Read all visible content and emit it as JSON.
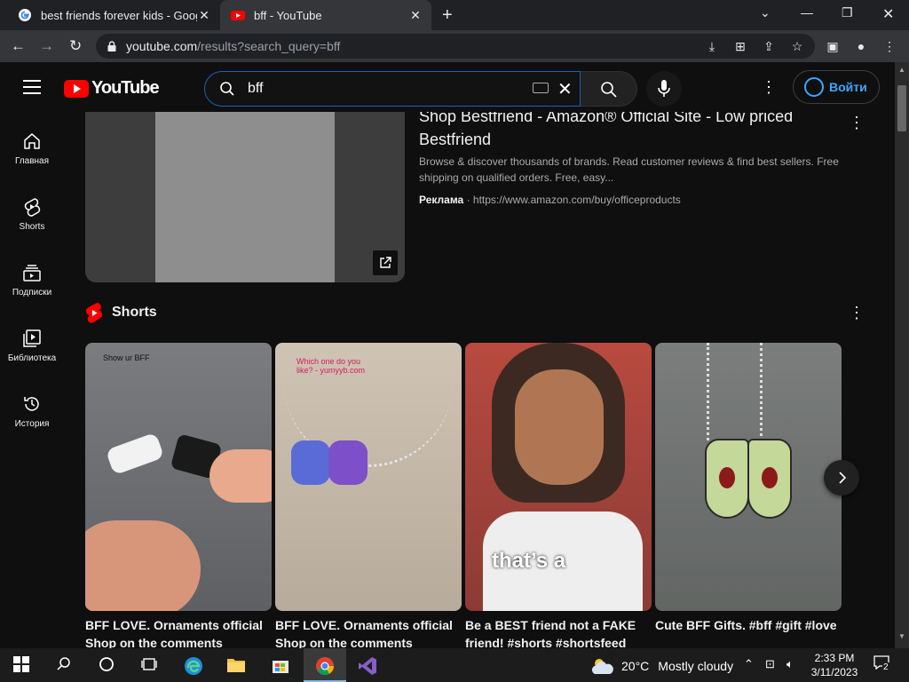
{
  "browser": {
    "tabs": [
      {
        "title": "best friends forever kids - Google",
        "active": false
      },
      {
        "title": "bff - YouTube",
        "active": true
      }
    ],
    "url_domain": "youtube.com",
    "url_path": "/results?search_query=bff"
  },
  "youtube": {
    "logo_text": "YouTube",
    "search_value": "bff",
    "signin_label": "Войти",
    "sidebar": [
      {
        "label": "Главная",
        "icon": "home-icon"
      },
      {
        "label": "Shorts",
        "icon": "shorts-icon"
      },
      {
        "label": "Подписки",
        "icon": "subscriptions-icon"
      },
      {
        "label": "Библиотека",
        "icon": "library-icon"
      },
      {
        "label": "История",
        "icon": "history-icon"
      }
    ],
    "ad": {
      "title": "Shop Bestfriend - Amazon® Official Site - Low priced Bestfriend",
      "description": "Browse & discover thousands of brands. Read customer reviews & find best sellers. Free shipping on qualified orders. Free, easy...",
      "badge": "Реклама",
      "url": "https://www.amazon.com/buy/officeproducts"
    },
    "shorts_heading": "Shorts",
    "shorts": [
      {
        "title": "BFF LOVE. Ornaments official Shop on the comments",
        "overlay": "Show ur BFF"
      },
      {
        "title": "BFF LOVE. Ornaments official Shop on the comments",
        "overlay": "Which one do you like? - yumyyb.com"
      },
      {
        "title": "Be a BEST friend not a FAKE friend! #shorts #shortsfeed",
        "overlay": "that’s a"
      },
      {
        "title": "Cute BFF Gifts. #bff #gift #love",
        "overlay": ""
      }
    ]
  },
  "taskbar": {
    "weather_temp": "20°C",
    "weather_desc": "Mostly cloudy",
    "time": "2:33 PM",
    "date": "3/11/2023",
    "notifications": "2"
  },
  "colors": {
    "youtube_red": "#ff0000",
    "link_blue": "#3ea6ff",
    "focus_blue": "#1c62b9"
  }
}
